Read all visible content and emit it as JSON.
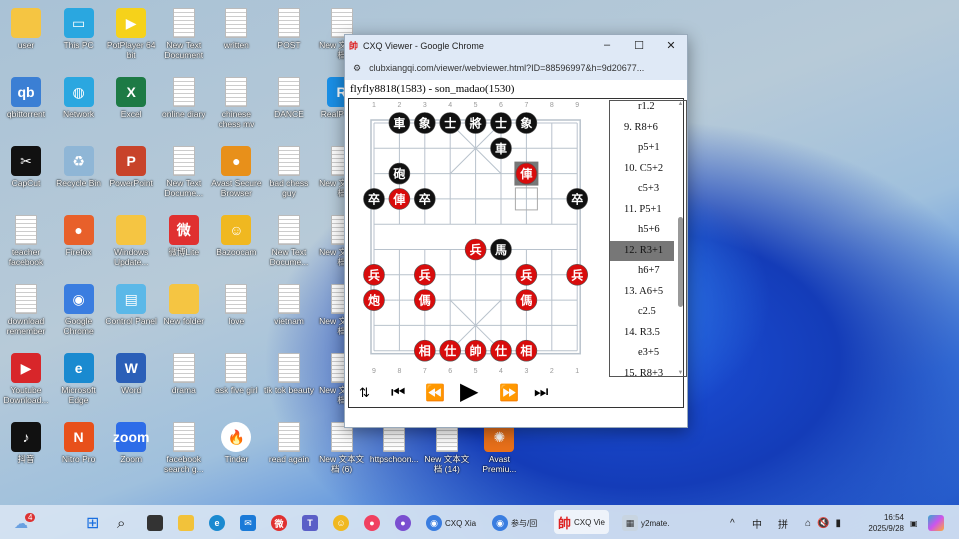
{
  "desktop": {
    "icons": [
      {
        "label": "user",
        "c": 0,
        "r": 0,
        "kind": "folder",
        "color": "#f5c542"
      },
      {
        "label": "This PC",
        "c": 1,
        "r": 0,
        "kind": "app",
        "color": "#2aa7e0",
        "glyph": "▭"
      },
      {
        "label": "PotPlayer 64 bit",
        "c": 2,
        "r": 0,
        "kind": "app",
        "color": "#f6d21a",
        "glyph": "▶"
      },
      {
        "label": "New Text Document",
        "c": 3,
        "r": 0,
        "kind": "doc"
      },
      {
        "label": "written",
        "c": 4,
        "r": 0,
        "kind": "doc"
      },
      {
        "label": "POST",
        "c": 5,
        "r": 0,
        "kind": "doc"
      },
      {
        "label": "New 文本文档",
        "c": 6,
        "r": 0,
        "kind": "doc"
      },
      {
        "label": "qbittorrent",
        "c": 0,
        "r": 1,
        "kind": "app",
        "color": "#3b7fd4",
        "glyph": "qb"
      },
      {
        "label": "Network",
        "c": 1,
        "r": 1,
        "kind": "app",
        "color": "#2aa7e0",
        "glyph": "◍"
      },
      {
        "label": "Excel",
        "c": 2,
        "r": 1,
        "kind": "app",
        "color": "#1d7a45",
        "glyph": "X"
      },
      {
        "label": "online diary",
        "c": 3,
        "r": 1,
        "kind": "doc"
      },
      {
        "label": "chinese chess mv",
        "c": 4,
        "r": 1,
        "kind": "doc"
      },
      {
        "label": "DANCE",
        "c": 5,
        "r": 1,
        "kind": "doc"
      },
      {
        "label": "RealPlayer",
        "c": 6,
        "r": 1,
        "kind": "app",
        "color": "#1a8fe6",
        "glyph": "R"
      },
      {
        "label": "CapCut",
        "c": 0,
        "r": 2,
        "kind": "app",
        "color": "#111",
        "glyph": "✂"
      },
      {
        "label": "Recycle Bin",
        "c": 1,
        "r": 2,
        "kind": "app",
        "color": "#8fb6d6",
        "glyph": "♻"
      },
      {
        "label": "PowerPoint",
        "c": 2,
        "r": 2,
        "kind": "app",
        "color": "#c8432a",
        "glyph": "P"
      },
      {
        "label": "New Text Docume...",
        "c": 3,
        "r": 2,
        "kind": "doc"
      },
      {
        "label": "Avast Secure Browser",
        "c": 4,
        "r": 2,
        "kind": "app",
        "color": "#e8901a",
        "glyph": "●"
      },
      {
        "label": "bad chess guy",
        "c": 5,
        "r": 2,
        "kind": "doc"
      },
      {
        "label": "New 文本文档",
        "c": 6,
        "r": 2,
        "kind": "doc"
      },
      {
        "label": "teacher facebook",
        "c": 0,
        "r": 3,
        "kind": "doc"
      },
      {
        "label": "Firefox",
        "c": 1,
        "r": 3,
        "kind": "app",
        "color": "#e8602a",
        "glyph": "●"
      },
      {
        "label": "Windows Update...",
        "c": 2,
        "r": 3,
        "kind": "folder",
        "color": "#f5c542"
      },
      {
        "label": "微博Lite",
        "c": 3,
        "r": 3,
        "kind": "app",
        "color": "#e03030",
        "glyph": "微"
      },
      {
        "label": "Bazoocam",
        "c": 4,
        "r": 3,
        "kind": "app",
        "color": "#f0b820",
        "glyph": "☺"
      },
      {
        "label": "New Text Docume...",
        "c": 5,
        "r": 3,
        "kind": "doc"
      },
      {
        "label": "New 文本文档",
        "c": 6,
        "r": 3,
        "kind": "doc"
      },
      {
        "label": "download remember",
        "c": 0,
        "r": 4,
        "kind": "doc"
      },
      {
        "label": "Google Chrome",
        "c": 1,
        "r": 4,
        "kind": "app",
        "color": "#3a7de0",
        "glyph": "◉"
      },
      {
        "label": "Control Panel",
        "c": 2,
        "r": 4,
        "kind": "app",
        "color": "#5bb8e8",
        "glyph": "▤"
      },
      {
        "label": "New folder",
        "c": 3,
        "r": 4,
        "kind": "folder",
        "color": "#f5c542"
      },
      {
        "label": "love",
        "c": 4,
        "r": 4,
        "kind": "doc"
      },
      {
        "label": "vietnam",
        "c": 5,
        "r": 4,
        "kind": "doc"
      },
      {
        "label": "New 文本文档",
        "c": 6,
        "r": 4,
        "kind": "doc"
      },
      {
        "label": "Youtube Download...",
        "c": 0,
        "r": 5,
        "kind": "app",
        "color": "#d8262a",
        "glyph": "▶"
      },
      {
        "label": "Microsoft Edge",
        "c": 1,
        "r": 5,
        "kind": "app",
        "color": "#1a8ad0",
        "glyph": "e"
      },
      {
        "label": "Word",
        "c": 2,
        "r": 5,
        "kind": "app",
        "color": "#2b5fb8",
        "glyph": "W"
      },
      {
        "label": "drama",
        "c": 3,
        "r": 5,
        "kind": "doc"
      },
      {
        "label": "ask five girl",
        "c": 4,
        "r": 5,
        "kind": "doc"
      },
      {
        "label": "tik tok beauty",
        "c": 5,
        "r": 5,
        "kind": "doc"
      },
      {
        "label": "New 文本文档",
        "c": 6,
        "r": 5,
        "kind": "doc"
      },
      {
        "label": "抖音",
        "c": 0,
        "r": 6,
        "kind": "app",
        "color": "#111",
        "glyph": "♪"
      },
      {
        "label": "Nitro Pro",
        "c": 1,
        "r": 6,
        "kind": "app",
        "color": "#e8501a",
        "glyph": "N"
      },
      {
        "label": "Zoom",
        "c": 2,
        "r": 6,
        "kind": "app",
        "color": "#2d6ce8",
        "glyph": "zoom"
      },
      {
        "label": "facebook search g...",
        "c": 3,
        "r": 6,
        "kind": "doc"
      },
      {
        "label": "Tinder",
        "c": 4,
        "r": 6,
        "kind": "app",
        "color": "#fff",
        "glyph": "🔥"
      },
      {
        "label": "read again",
        "c": 5,
        "r": 6,
        "kind": "doc"
      },
      {
        "label": "New 文本文档 (6)",
        "c": 6,
        "r": 6,
        "kind": "doc"
      },
      {
        "label": "httpschoon...",
        "c": 7,
        "r": 6,
        "kind": "doc"
      },
      {
        "label": "New 文本文档 (14)",
        "c": 8,
        "r": 6,
        "kind": "doc"
      },
      {
        "label": "Avast Premiu...",
        "c": 9,
        "r": 6,
        "kind": "app",
        "color": "#e8701a",
        "glyph": "✺"
      }
    ]
  },
  "window": {
    "title": "CXQ Viewer - Google Chrome",
    "url": "clubxiangqi.com/viewer/webviewer.html?ID=88596997&h=9d20677...",
    "game_title": "flyfly8818(1583) - son_madao(1530)",
    "top_files": [
      "1",
      "2",
      "3",
      "4",
      "5",
      "6",
      "7",
      "8",
      "9"
    ],
    "bottom_files": [
      "9",
      "8",
      "7",
      "6",
      "5",
      "4",
      "3",
      "2",
      "1"
    ],
    "pieces": [
      {
        "ch": "車",
        "side": "black",
        "f": 2,
        "r": 0
      },
      {
        "ch": "象",
        "side": "black",
        "f": 3,
        "r": 0
      },
      {
        "ch": "士",
        "side": "black",
        "f": 4,
        "r": 0
      },
      {
        "ch": "將",
        "side": "black",
        "f": 5,
        "r": 0
      },
      {
        "ch": "士",
        "side": "black",
        "f": 6,
        "r": 0
      },
      {
        "ch": "象",
        "side": "black",
        "f": 7,
        "r": 0
      },
      {
        "ch": "車",
        "side": "black",
        "f": 6,
        "r": 1
      },
      {
        "ch": "砲",
        "side": "black",
        "f": 2,
        "r": 2
      },
      {
        "ch": "卒",
        "side": "black",
        "f": 1,
        "r": 3
      },
      {
        "ch": "卒",
        "side": "black",
        "f": 3,
        "r": 3
      },
      {
        "ch": "卒",
        "side": "black",
        "f": 9,
        "r": 3
      },
      {
        "ch": "馬",
        "side": "black",
        "f": 6,
        "r": 5
      },
      {
        "ch": "俥",
        "side": "red",
        "f": 7,
        "r": 2,
        "last": true
      },
      {
        "ch": "俥",
        "side": "red",
        "f": 2,
        "r": 3
      },
      {
        "ch": "兵",
        "side": "red",
        "f": 5,
        "r": 5
      },
      {
        "ch": "兵",
        "side": "red",
        "f": 1,
        "r": 6
      },
      {
        "ch": "兵",
        "side": "red",
        "f": 3,
        "r": 6
      },
      {
        "ch": "兵",
        "side": "red",
        "f": 7,
        "r": 6
      },
      {
        "ch": "兵",
        "side": "red",
        "f": 9,
        "r": 6
      },
      {
        "ch": "炮",
        "side": "red",
        "f": 1,
        "r": 7
      },
      {
        "ch": "傌",
        "side": "red",
        "f": 3,
        "r": 7
      },
      {
        "ch": "傌",
        "side": "red",
        "f": 7,
        "r": 7
      },
      {
        "ch": "相",
        "side": "red",
        "f": 3,
        "r": 9
      },
      {
        "ch": "仕",
        "side": "red",
        "f": 4,
        "r": 9
      },
      {
        "ch": "帥",
        "side": "red",
        "f": 5,
        "r": 9
      },
      {
        "ch": "仕",
        "side": "red",
        "f": 6,
        "r": 9
      },
      {
        "ch": "相",
        "side": "red",
        "f": 7,
        "r": 9
      }
    ],
    "last_from": {
      "f": 7,
      "r": 3
    },
    "moves": [
      {
        "t": "r1.2"
      },
      {
        "t": "9. R8+6",
        "n": true
      },
      {
        "t": "p5+1"
      },
      {
        "t": "10. C5+2",
        "n": true
      },
      {
        "t": "c5+3"
      },
      {
        "t": "11. P5+1",
        "n": true
      },
      {
        "t": "h5+6"
      },
      {
        "t": "12. R3+1",
        "n": true,
        "sel": true
      },
      {
        "t": "h6+7"
      },
      {
        "t": "13. A6+5",
        "n": true
      },
      {
        "t": "c2.5"
      },
      {
        "t": "14. R3.5",
        "n": true
      },
      {
        "t": "e3+5"
      },
      {
        "t": "15. R8+3",
        "n": true
      }
    ]
  },
  "taskbar": {
    "weather_badge": "4",
    "apps": [
      {
        "label": "CXQ Xia"
      },
      {
        "label": "参与/回"
      },
      {
        "label": "CXQ Vie"
      },
      {
        "label": "y2mate."
      }
    ],
    "ime1": "中",
    "ime2": "拼",
    "time": "16:54",
    "date": "2025/9/28"
  }
}
